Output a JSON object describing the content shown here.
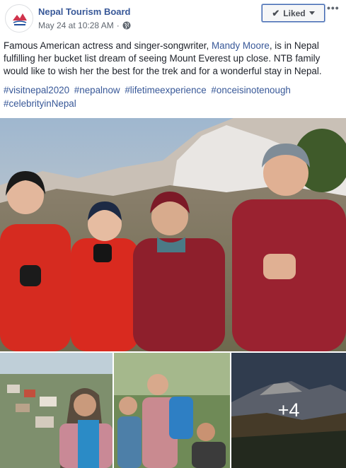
{
  "post": {
    "page_name": "Nepal Tourism Board",
    "timestamp": "May 24 at 10:28 AM",
    "separator": "·",
    "privacy_icon": "globe-icon",
    "liked_label": "Liked",
    "more_label": "•••",
    "text_before": "Famous American actress and singer-songwriter, ",
    "mention": "Mandy Moore",
    "text_after": ", is in Nepal fulfilling her bucket list dream of seeing Mount Everest up close. NTB family would like to wish her the best for the trek and for a wonderful stay in Nepal.",
    "hashtags": [
      "#visitnepal2020",
      "#nepalnow",
      "#lifetimeexperience",
      "#onceisinotenough",
      "#celebrityinNepal"
    ]
  },
  "photos": {
    "more_count": "+4"
  },
  "colors": {
    "link": "#385898",
    "accent": "#4267b2"
  }
}
